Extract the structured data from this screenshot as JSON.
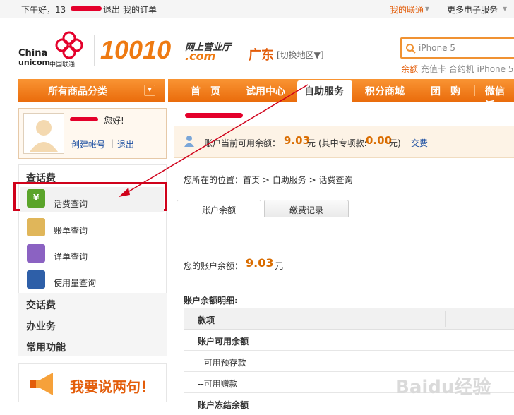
{
  "topbar": {
    "greeting": "下午好，13",
    "logout": "退出",
    "orders": "我的订单",
    "my_unicom": "我的联通",
    "more_services": "更多电子服务"
  },
  "header": {
    "brand_en_1": "China",
    "brand_en_2": "unicom",
    "brand_cn": "中国联通",
    "site_number": "10010",
    "site_sub_1": "网上营业厅",
    "site_sub_2": ".com",
    "region": "广东",
    "switch_region": "[切换地区▼]",
    "search_placeholder": "iPhone 5",
    "hot_links": [
      "余额",
      "充值卡",
      "合约机",
      "iPhone 5"
    ]
  },
  "nav": {
    "all_categories": "所有商品分类",
    "items": [
      "首　页",
      "试用中心",
      "自助服务",
      "积分商城",
      "团　购",
      "微信沃"
    ]
  },
  "user": {
    "greeting": "您好!",
    "create_account": "创建帐号",
    "separator": "|",
    "logout": "退出"
  },
  "account_bar": {
    "label": "账户当前可用余额：",
    "balance": "9.03",
    "unit": "元",
    "special_label": "(其中专项款:",
    "special_value": "0.00",
    "special_unit": "元)",
    "pay": "交费"
  },
  "sidebar": {
    "section_1": "查话费",
    "items": [
      "话费查询",
      "账单查询",
      "详单查询",
      "使用量查询"
    ],
    "section_2": "交话费",
    "section_3": "办业务",
    "section_4": "常用功能",
    "promo": "我要说两句！"
  },
  "breadcrumb": {
    "label": "您所在的位置：",
    "path": [
      "首页",
      "自助服务",
      "话费查询"
    ],
    "sep": ">"
  },
  "tabs": [
    "账户余额",
    "缴费记录"
  ],
  "balance_section": {
    "label": "您的账户余额：",
    "value": "9.03",
    "unit": "元",
    "detail_title": "账户余额明细:",
    "table_header": "款项",
    "rows": [
      "账户可用余额",
      "--可用预存款",
      "--可用赠款",
      "账户冻结余额"
    ]
  },
  "watermark": "Baidu经验",
  "colors": {
    "brand_orange": "#ea6c0c",
    "brand_red": "#e4002b",
    "amount_orange": "#d96c00",
    "link_blue": "#1e50a2"
  }
}
